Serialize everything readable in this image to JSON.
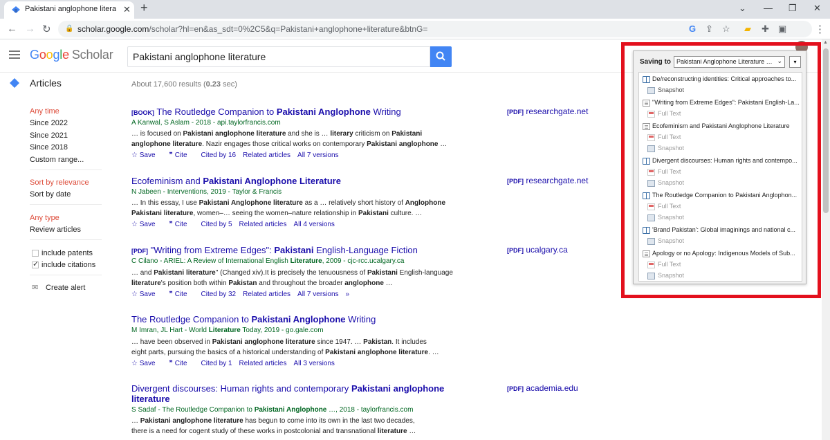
{
  "browser": {
    "tab_title": "Pakistani anglophone literature -",
    "tab_close": "✕",
    "new_tab": "+",
    "url_host": "scholar.google.com",
    "url_path": "/scholar?hl=en&as_sdt=0%2C5&q=Pakistani+anglophone+literature&btnG=",
    "window_min": "—",
    "window_max": "❐",
    "window_close": "✕"
  },
  "header": {
    "logo_google": [
      "G",
      "o",
      "o",
      "g",
      "l",
      "e"
    ],
    "logo_scholar": "Scholar",
    "search_value": "Pakistani anglophone literature",
    "section": "Articles",
    "stats_prefix": "About 17,600 results (",
    "stats_time": "0.23",
    "stats_suffix": " sec)"
  },
  "sidebar": {
    "time": [
      "Any time",
      "Since 2022",
      "Since 2021",
      "Since 2018",
      "Custom range..."
    ],
    "sort": [
      "Sort by relevance",
      "Sort by date"
    ],
    "type": [
      "Any type",
      "Review articles"
    ],
    "include_patents": "include patents",
    "include_citations": "include citations",
    "create_alert": "Create alert"
  },
  "results": [
    {
      "tag": "[BOOK]",
      "title_a": "The Routledge Companion to ",
      "title_b": "Pakistani Anglophone",
      "title_c": " Writing",
      "meta": "A Kanwal, S Aslam - 2018 - api.taylorfrancis.com",
      "snippet1_a": "… is focused on ",
      "snippet1_b": "Pakistani anglophone literature",
      "snippet1_c": " and she is … ",
      "snippet1_d": "literary",
      "snippet1_e": " criticism on ",
      "snippet1_f": "Pakistani",
      "snippet2_a": "anglophone literature",
      "snippet2_b": ". Nazir engages those critical works on contemporary ",
      "snippet2_c": "Pakistani anglophone",
      "snippet2_d": " …",
      "save": "Save",
      "cite": "Cite",
      "cited": "Cited by 16",
      "related": "Related articles",
      "versions": "All 7 versions",
      "pdf_tag": "[PDF]",
      "pdf_src": "researchgate.net"
    },
    {
      "title_a": "Ecofeminism and ",
      "title_b": "Pakistani Anglophone Literature",
      "meta": "N Jabeen - Interventions, 2019 - Taylor & Francis",
      "snippet1_a": "… In this essay, I use ",
      "snippet1_b": "Pakistani Anglophone literature",
      "snippet1_c": " as a … relatively short history of ",
      "snippet1_d": "Anglophone",
      "snippet2_a": "Pakistani literature",
      "snippet2_b": ", women–… seeing the women–nature relationship in ",
      "snippet2_c": "Pakistani",
      "snippet2_d": " culture. …",
      "save": "Save",
      "cite": "Cite",
      "cited": "Cited by 5",
      "related": "Related articles",
      "versions": "All 4 versions",
      "pdf_tag": "[PDF]",
      "pdf_src": "researchgate.net"
    },
    {
      "tag": "[PDF]",
      "title_a": "\"Writing from Extreme Edges\": ",
      "title_b": "Pakistani",
      "title_c": " English-Language Fiction",
      "meta_a": "C Cilano - ARIEL: A Review of International English ",
      "meta_b": "Literature",
      "meta_c": ", 2009 - cjc-rcc.ucalgary.ca",
      "snippet1_a": "… and ",
      "snippet1_b": "Pakistani literature",
      "snippet1_c": "\" (Changed xiv).It is precisely the tenuousness of ",
      "snippet1_d": "Pakistani",
      "snippet1_e": " English-language",
      "snippet2_a": "literature",
      "snippet2_b": "'s position both within ",
      "snippet2_c": "Pakistan",
      "snippet2_d": " and throughout the broader ",
      "snippet2_e": "anglophone",
      "snippet2_f": " …",
      "save": "Save",
      "cite": "Cite",
      "cited": "Cited by 32",
      "related": "Related articles",
      "versions": "All 7 versions",
      "more": "»",
      "pdf_tag": "[PDF]",
      "pdf_src": "ucalgary.ca"
    },
    {
      "title_a": "The Routledge Companion to ",
      "title_b": "Pakistani Anglophone",
      "title_c": " Writing",
      "meta_a": "M Imran, JL Hart - World ",
      "meta_b": "Literature",
      "meta_c": " Today, 2019 - go.gale.com",
      "snippet1_a": "… have been observed in ",
      "snippet1_b": "Pakistani anglophone literature",
      "snippet1_c": " since 1947. … ",
      "snippet1_d": "Pakistan",
      "snippet1_e": ". It includes",
      "snippet2_a": "eight parts, pursuing the basics of a historical understanding of ",
      "snippet2_b": "Pakistani anglophone literature",
      "snippet2_c": ". …",
      "save": "Save",
      "cite": "Cite",
      "cited": "Cited by 1",
      "related": "Related articles",
      "versions": "All 3 versions"
    },
    {
      "title_a": "Divergent discourses: Human rights and contemporary ",
      "title_b": "Pakistani anglophone",
      "title_line2": "literature",
      "meta_a": "S Sadaf - The Routledge Companion to ",
      "meta_b": "Pakistani Anglophone",
      "meta_c": " …, 2018 - taylorfrancis.com",
      "snippet1_a": "… ",
      "snippet1_b": "Pakistani anglophone literature",
      "snippet1_c": " has begun to come into its own in the last two decades,",
      "snippet2_a": "there is a need for cogent study of these works in postcolonial and transnational ",
      "snippet2_b": "literature",
      "snippet2_c": " …",
      "pdf_tag": "[PDF]",
      "pdf_src": "academia.edu"
    }
  ],
  "zotero": {
    "saving_to": "Saving to",
    "collection": "Pakistani Anglophone Literature …",
    "more": "▾",
    "items": [
      {
        "icon": "book",
        "title": "De/reconstructing identities: Critical approaches to...",
        "subs": [
          {
            "icon": "snap",
            "label": "Snapshot",
            "dim": false
          }
        ]
      },
      {
        "icon": "doc",
        "title": "\"Writing from Extreme Edges\": Pakistani English-La...",
        "subs": [
          {
            "icon": "pdf",
            "label": "Full Text",
            "dim": true
          }
        ]
      },
      {
        "icon": "doc",
        "title": "Ecofeminism and Pakistani Anglophone Literature",
        "subs": [
          {
            "icon": "pdf",
            "label": "Full Text",
            "dim": true
          },
          {
            "icon": "snap",
            "label": "Snapshot",
            "dim": true
          }
        ]
      },
      {
        "icon": "book",
        "title": "Divergent discourses: Human rights and contempo...",
        "subs": [
          {
            "icon": "pdf",
            "label": "Full Text",
            "dim": true
          },
          {
            "icon": "snap",
            "label": "Snapshot",
            "dim": true
          }
        ]
      },
      {
        "icon": "book2",
        "title": "The Routledge Companion to Pakistani Anglophon...",
        "subs": [
          {
            "icon": "pdf",
            "label": "Full Text",
            "dim": true
          },
          {
            "icon": "snap",
            "label": "Snapshot",
            "dim": true
          }
        ]
      },
      {
        "icon": "book",
        "title": "'Brand Pakistan': Global imaginings and national c...",
        "subs": [
          {
            "icon": "snap",
            "label": "Snapshot",
            "dim": true
          }
        ]
      },
      {
        "icon": "doc",
        "title": "Apology or no Apology: Indigenous Models of Sub...",
        "subs": [
          {
            "icon": "pdf",
            "label": "Full Text",
            "dim": true
          },
          {
            "icon": "snap",
            "label": "Snapshot",
            "dim": true
          }
        ]
      }
    ]
  },
  "colors": {
    "link": "#1a0dab",
    "meta": "#006621",
    "filter_active": "#dd4b39",
    "search_button": "#4285f4",
    "highlight_box": "#e3101d"
  }
}
